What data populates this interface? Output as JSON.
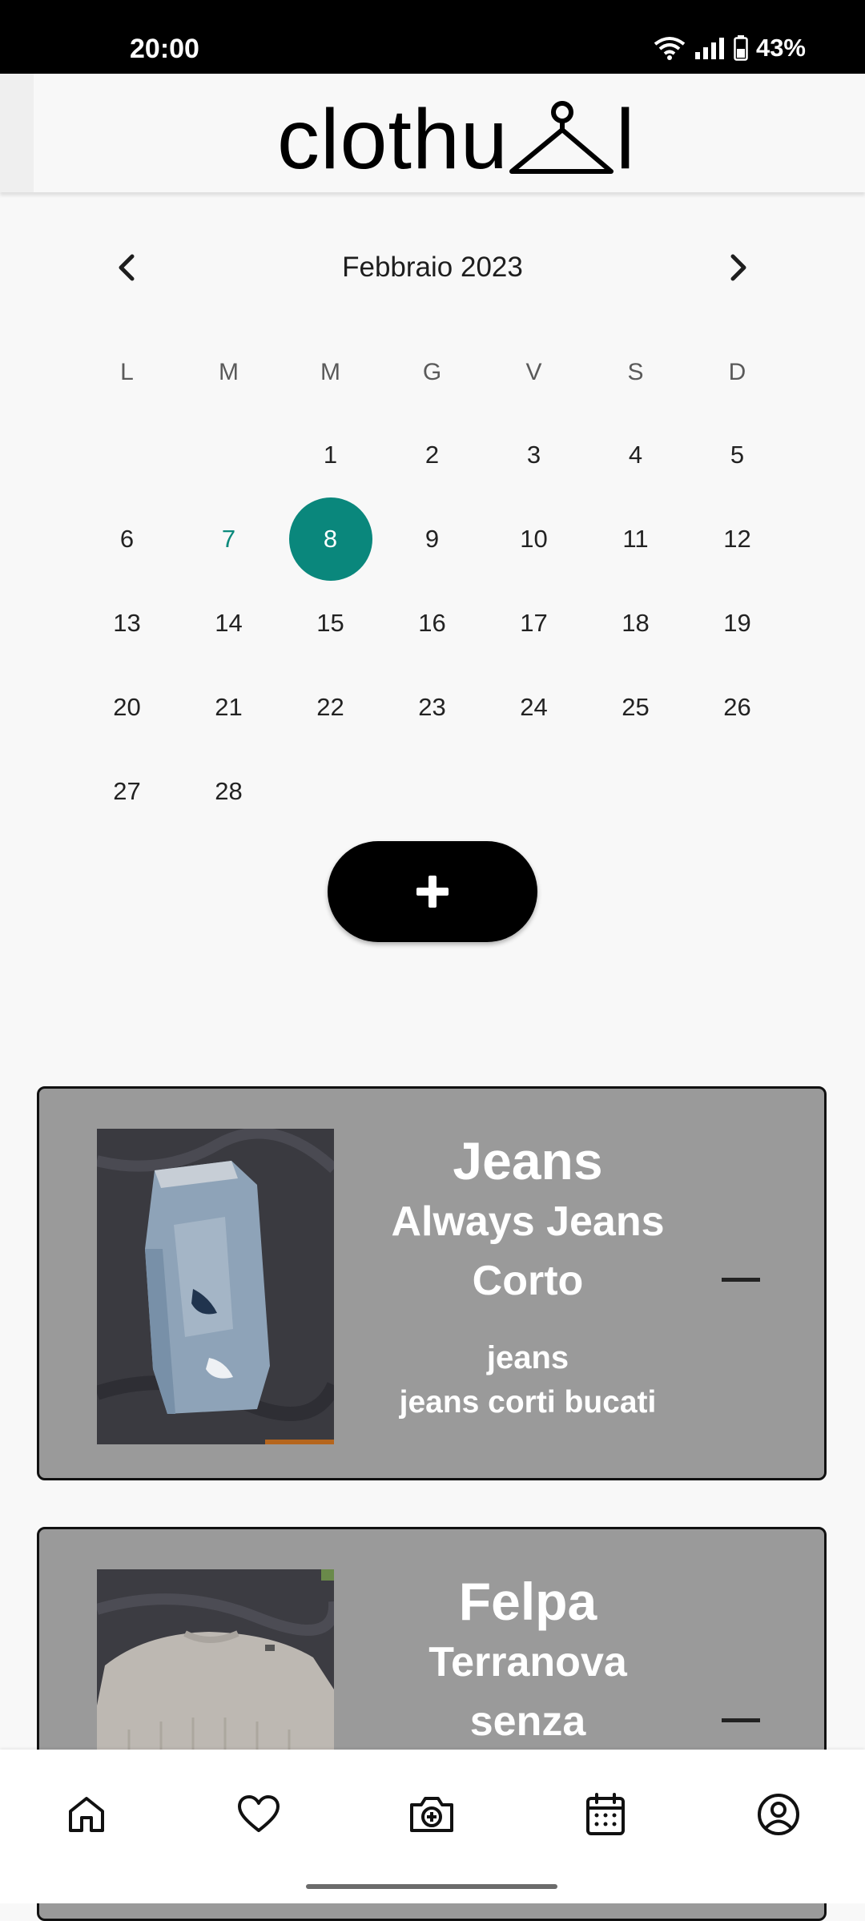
{
  "status_bar": {
    "time": "20:00",
    "battery": "43%",
    "icons": [
      "wifi-icon",
      "signal-icon",
      "battery-icon"
    ]
  },
  "header": {
    "logo_text": "clothu",
    "logo_tail": "l"
  },
  "calendar": {
    "month_label": "Febbraio 2023",
    "prev_icon": "chevron-left-icon",
    "next_icon": "chevron-right-icon",
    "weekdays": [
      "L",
      "M",
      "M",
      "G",
      "V",
      "S",
      "D"
    ],
    "leading_blanks": 2,
    "days": [
      "1",
      "2",
      "3",
      "4",
      "5",
      "6",
      "7",
      "8",
      "9",
      "10",
      "11",
      "12",
      "13",
      "14",
      "15",
      "16",
      "17",
      "18",
      "19",
      "20",
      "21",
      "22",
      "23",
      "24",
      "25",
      "26",
      "27",
      "28"
    ],
    "today": "7",
    "selected": "8",
    "accent_color": "#0a877c"
  },
  "add_button": {
    "icon": "plus-icon"
  },
  "items": [
    {
      "category": "Jeans",
      "brand": "Always Jeans",
      "fit": "Corto",
      "type": "jeans",
      "description": "jeans corti bucati"
    },
    {
      "category": "Felpa",
      "brand": "Terranova",
      "fit": "senza"
    }
  ],
  "bottom_nav": {
    "items": [
      "home-icon",
      "heart-icon",
      "camera-add-icon",
      "calendar-icon",
      "profile-icon"
    ]
  }
}
